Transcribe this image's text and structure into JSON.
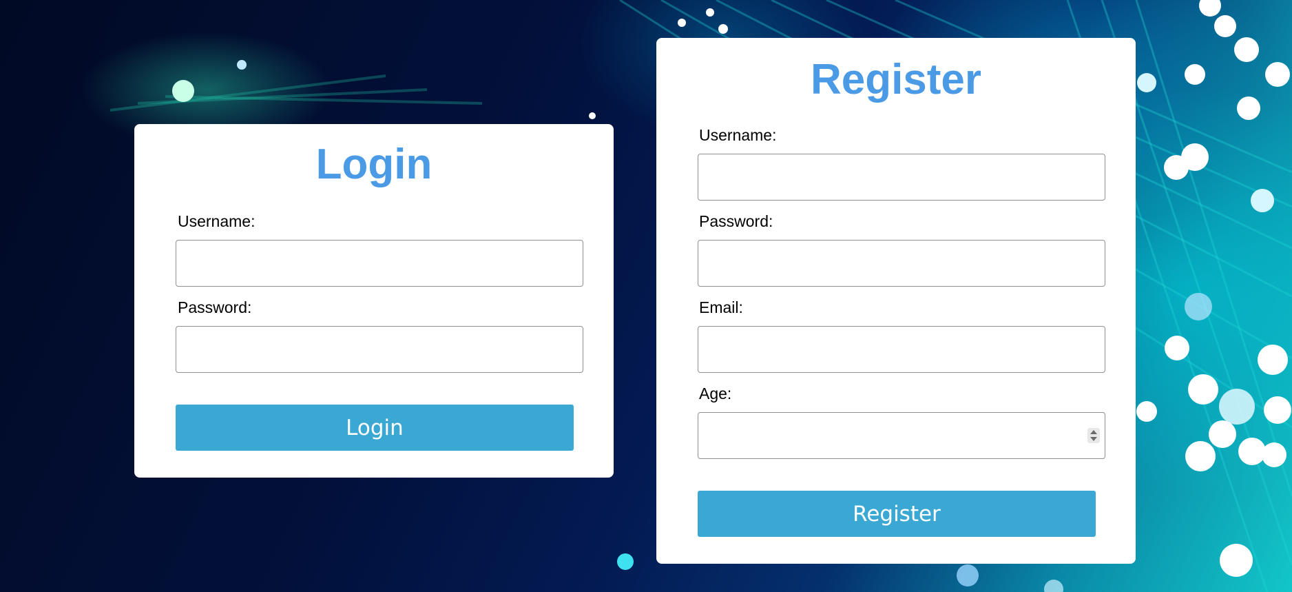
{
  "login": {
    "title": "Login",
    "username_label": "Username:",
    "username_value": "",
    "password_label": "Password:",
    "password_value": "",
    "submit_label": "Login"
  },
  "register": {
    "title": "Register",
    "username_label": "Username:",
    "username_value": "",
    "password_label": "Password:",
    "password_value": "",
    "email_label": "Email:",
    "email_value": "",
    "age_label": "Age:",
    "age_value": "",
    "submit_label": "Register"
  },
  "colors": {
    "title": "#4a9ae6",
    "button": "#3ba8d4",
    "card": "#ffffff"
  },
  "icons": {
    "age_spinner": "spinner-arrows-icon"
  }
}
